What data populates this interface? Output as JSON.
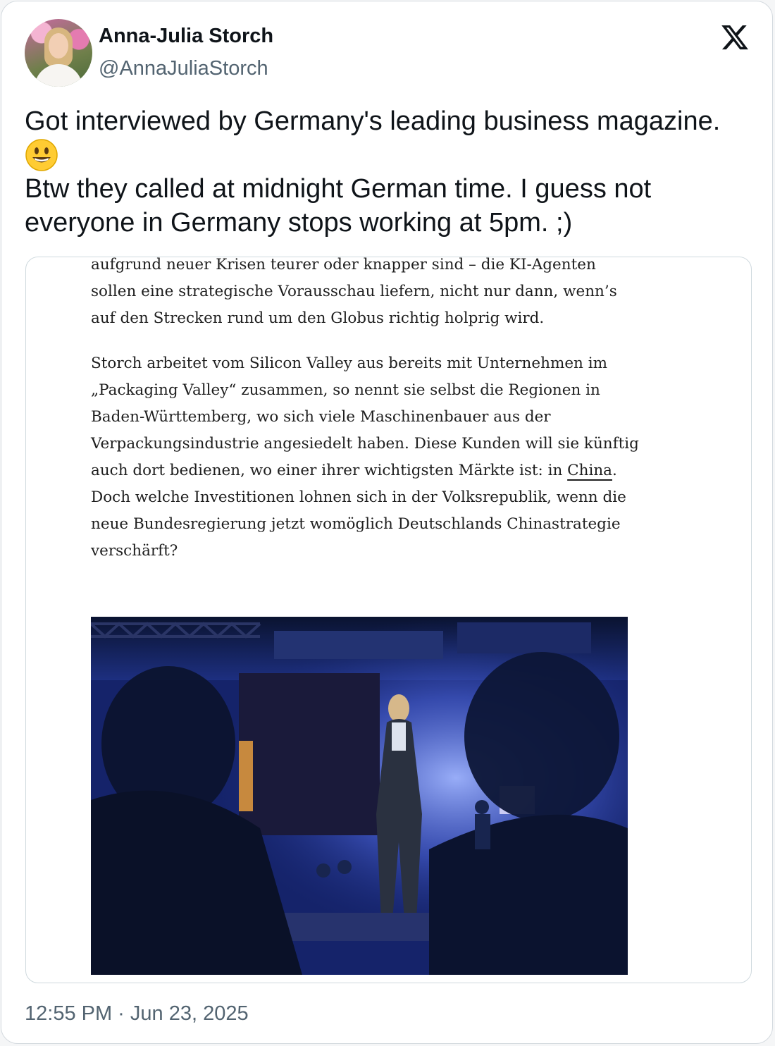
{
  "author": {
    "name": "Anna-Julia Storch",
    "handle": "@AnnaJuliaStorch"
  },
  "tweet": {
    "line1": "Got interviewed by Germany's leading business magazine.",
    "line3": "Btw they called at midnight German time. I guess not",
    "line4": "everyone in Germany stops working at 5pm. ;)",
    "emoji": "smiling-face-icon"
  },
  "article": {
    "p1": [
      "aufgrund neuer Krisen teurer oder knapper sind – die KI-Agenten",
      "sollen eine strategische Vorausschau liefern, nicht nur dann, wenn’s",
      "auf den Strecken rund um den Globus richtig holprig wird."
    ],
    "p2": [
      "Storch arbeitet vom Silicon Valley aus bereits mit Unternehmen im",
      "„Packaging Valley“ zusammen, so nennt sie selbst die Regionen in",
      "Baden-Württemberg, wo sich viele Maschinenbauer aus der",
      "Verpackungsindustrie angesiedelt haben. Diese Kunden will sie künftig",
      "auch dort bedienen, wo einer ihrer wichtigsten Märkte ist: in ",
      "China",
      ".",
      "Doch welche Investitionen lohnen sich in der Volksrepublik, wenn die",
      "neue Bundesregierung jetzt womöglich Deutschlands Chinastrategie",
      "verschärft?"
    ]
  },
  "timestamp": "12:55 PM · Jun 23, 2025",
  "colors": {
    "text": "#0f1419",
    "secondary": "#536471",
    "border": "#cfd9de"
  }
}
